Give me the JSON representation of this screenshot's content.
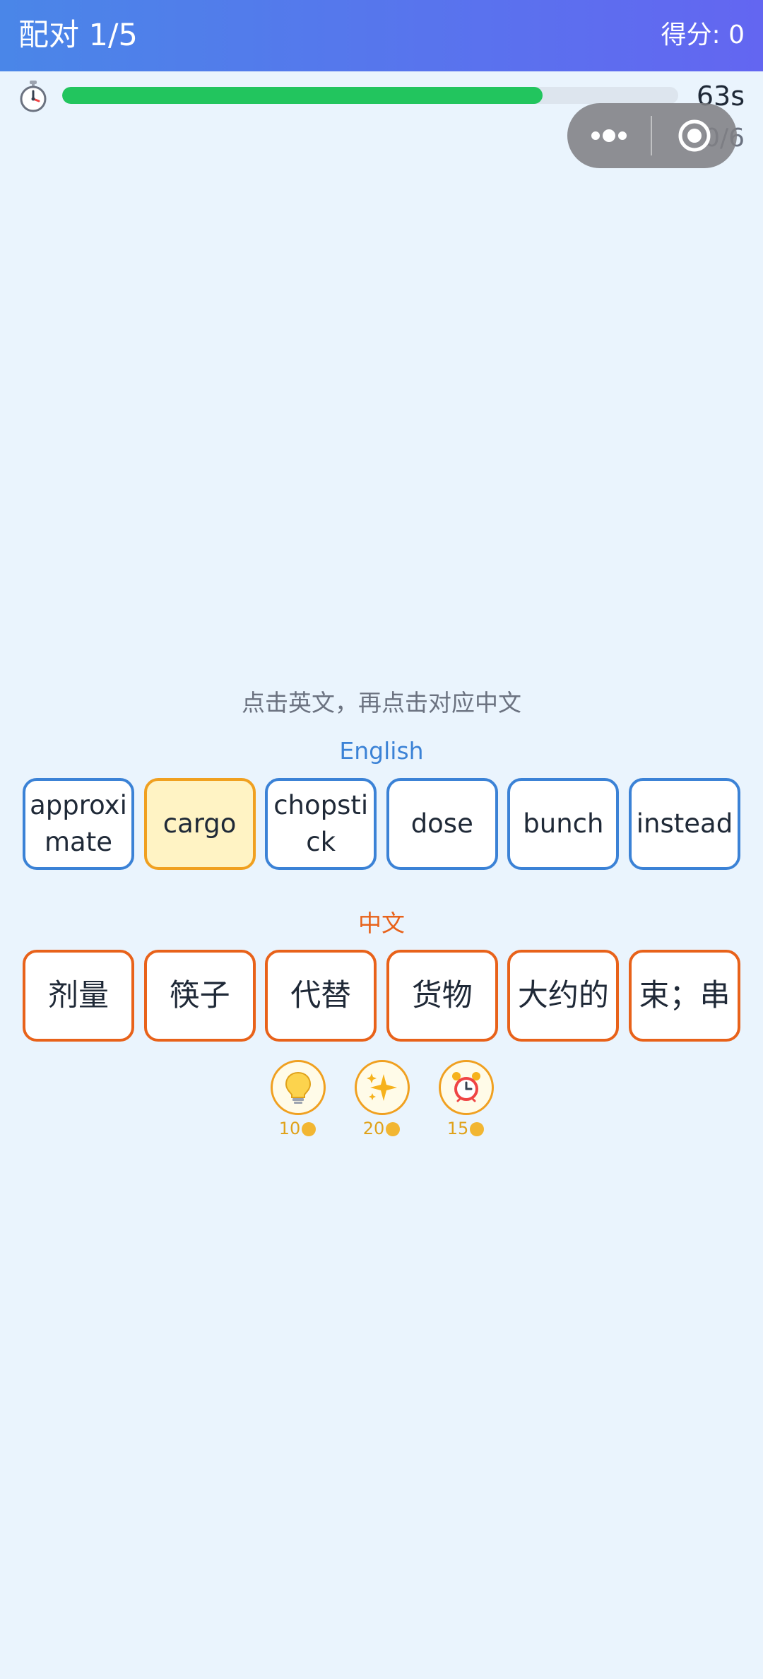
{
  "header": {
    "title": "配对 1/5",
    "score": "得分: 0"
  },
  "timer": {
    "icon": "stopwatch-icon",
    "progress_fraction": 0.78,
    "time_left": "63s",
    "matched": "0/6"
  },
  "miniprogram_capsule": {
    "more_icon": "more-dots-icon",
    "close_icon": "target-close-icon"
  },
  "instruction": "点击英文，再点击对应中文",
  "english": {
    "label": "English",
    "cards": [
      {
        "text": "approximate",
        "selected": false
      },
      {
        "text": "cargo",
        "selected": true
      },
      {
        "text": "chopstick",
        "selected": false
      },
      {
        "text": "dose",
        "selected": false
      },
      {
        "text": "bunch",
        "selected": false
      },
      {
        "text": "instead",
        "selected": false
      }
    ]
  },
  "chinese": {
    "label": "中文",
    "cards": [
      {
        "text": "剂量"
      },
      {
        "text": "筷子"
      },
      {
        "text": "代替"
      },
      {
        "text": "货物"
      },
      {
        "text": "大约的"
      },
      {
        "text": "束；串"
      }
    ]
  },
  "tools": [
    {
      "icon": "lightbulb-icon",
      "cost": "10"
    },
    {
      "icon": "sparkle-icon",
      "cost": "20"
    },
    {
      "icon": "alarm-clock-icon",
      "cost": "15"
    }
  ],
  "colors": {
    "header_start": "#4a86e8",
    "header_end": "#6366f1",
    "english_border": "#3b82d6",
    "chinese_border": "#e8621a",
    "selected_bg": "#fff3c4",
    "selected_border": "#f0a020",
    "progress": "#22c55e",
    "page_bg": "#eaf4fd"
  }
}
